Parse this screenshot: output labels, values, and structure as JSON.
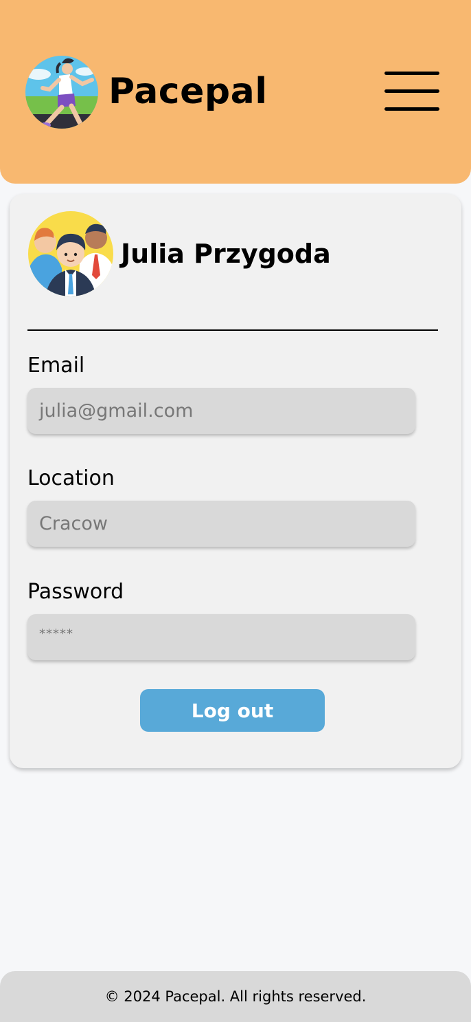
{
  "header": {
    "brand": "Pacepal",
    "logo_icon": "runner-logo-icon",
    "menu_icon": "hamburger-menu-icon",
    "background_color": "#f8b870"
  },
  "profile": {
    "name": "Julia Przygoda",
    "avatar_icon": "team-avatar-icon"
  },
  "fields": {
    "email": {
      "label": "Email",
      "value": "julia@gmail.com"
    },
    "location": {
      "label": "Location",
      "value": "Cracow"
    },
    "password": {
      "label": "Password",
      "value": "*****"
    }
  },
  "actions": {
    "logout_label": "Log out",
    "logout_color": "#58a9d8"
  },
  "footer": {
    "text": "© 2024 Pacepal. All rights reserved."
  }
}
